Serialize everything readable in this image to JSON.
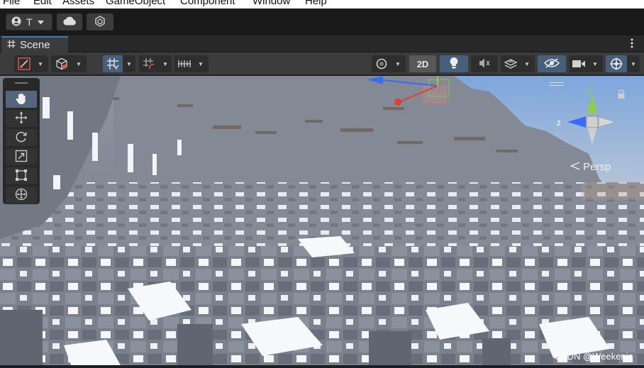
{
  "menu": {
    "items": [
      "File",
      "Edit",
      "Assets",
      "GameObject",
      "Component",
      "Window",
      "Help"
    ]
  },
  "top_toolbar": {
    "account_label": "T",
    "icons": [
      "account-icon",
      "cloud-icon",
      "collab-icon"
    ]
  },
  "tab": {
    "label": "Scene",
    "icon": "grid-hash-icon"
  },
  "scene_toolbar": {
    "button_2d": "2D",
    "icons": [
      "draw-mode-icon",
      "shading-icon",
      "grid-snap-icon",
      "increment-snap-icon",
      "ruler-icon",
      "orbit-icon",
      "lighting-icon",
      "audio-mute-icon",
      "effects-icon",
      "visibility-icon",
      "camera-icon",
      "gizmos-icon"
    ]
  },
  "tools": [
    "hand-tool",
    "move-tool",
    "rotate-tool",
    "scale-tool",
    "rect-tool",
    "transform-tool"
  ],
  "gizmo": {
    "projection_label": "Persp",
    "axis_y": "y",
    "axis_z": "z"
  },
  "watermark": "CSDN @Weekenic",
  "colors": {
    "accent": "#3a79bb",
    "active_button": "#46607c",
    "axis_y": "#8ed13c",
    "axis_z": "#3a6cf0",
    "axis_x": "#e0402e"
  }
}
